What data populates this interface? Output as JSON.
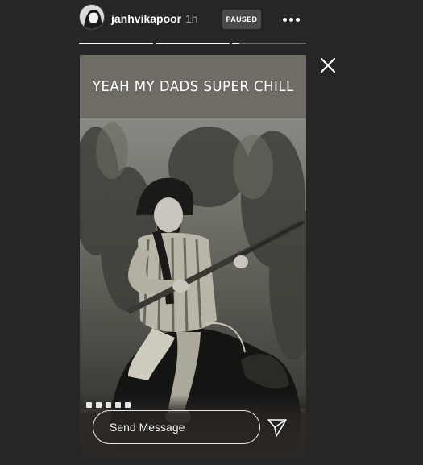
{
  "header": {
    "username": "janhvikapoor",
    "time": "1h",
    "status_badge": "PAUSED"
  },
  "progress": {
    "segments": 3,
    "current_fraction": 0.1
  },
  "story": {
    "caption": "YEAH MY DADS SUPER CHILL",
    "photo_description_icon": "sepia-photo"
  },
  "footer": {
    "message_placeholder": "Send Message"
  },
  "icons": {
    "more": "more-icon",
    "close": "close-icon",
    "send": "send-icon"
  },
  "colors": {
    "background": "#262626",
    "caption_band": "#6e6c64",
    "badge": "#4a4a4a"
  }
}
